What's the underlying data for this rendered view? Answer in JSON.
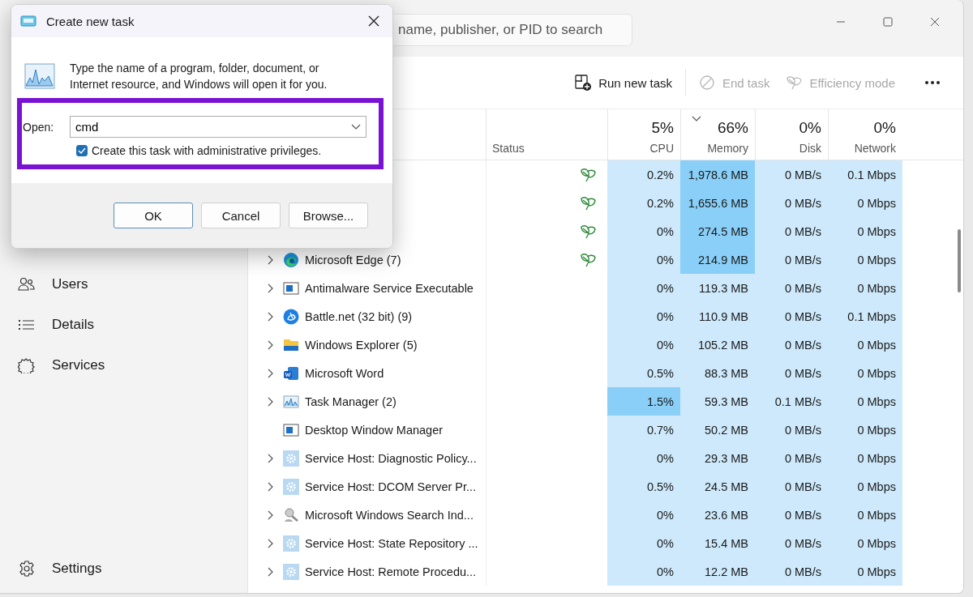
{
  "task_manager": {
    "search": {
      "placeholder": "name, publisher, or PID to search"
    },
    "toolbar": [
      {
        "label": "Run new task",
        "disabled": false
      },
      {
        "label": "End task",
        "disabled": true
      },
      {
        "label": "Efficiency mode",
        "disabled": true
      }
    ],
    "sidebar": {
      "items": [
        {
          "label": "Users"
        },
        {
          "label": "Details"
        },
        {
          "label": "Services"
        }
      ],
      "footer": {
        "label": "Settings"
      }
    },
    "table": {
      "status_header": {
        "label": "Status"
      },
      "columns": [
        {
          "percent": "5%",
          "label": "CPU",
          "sorted": false
        },
        {
          "percent": "66%",
          "label": "Memory",
          "sorted": true
        },
        {
          "percent": "0%",
          "label": "Disk",
          "sorted": false
        },
        {
          "percent": "0%",
          "label": "Network",
          "sorted": false
        }
      ],
      "rows": [
        {
          "efficiency": true,
          "cells": [
            {
              "text": "0.2%",
              "hot": false
            },
            {
              "text": "1,978.6 MB",
              "hot": true
            },
            {
              "text": "0 MB/s",
              "hot": false
            },
            {
              "text": "0.1 Mbps",
              "hot": false
            }
          ]
        },
        {
          "efficiency": true,
          "cells": [
            {
              "text": "0.2%",
              "hot": false
            },
            {
              "text": "1,655.6 MB",
              "hot": true
            },
            {
              "text": "0 MB/s",
              "hot": false
            },
            {
              "text": "0 Mbps",
              "hot": false
            }
          ]
        },
        {
          "efficiency": true,
          "cells": [
            {
              "text": "0%",
              "hot": false
            },
            {
              "text": "274.5 MB",
              "hot": true
            },
            {
              "text": "0 MB/s",
              "hot": false
            },
            {
              "text": "0 Mbps",
              "hot": false
            }
          ]
        },
        {
          "name": "Microsoft Edge (7)",
          "expandable": true,
          "efficiency": true,
          "cells": [
            {
              "text": "0%",
              "hot": false
            },
            {
              "text": "214.9 MB",
              "hot": true
            },
            {
              "text": "0 MB/s",
              "hot": false
            },
            {
              "text": "0 Mbps",
              "hot": false
            }
          ]
        },
        {
          "name": "Antimalware Service Executable",
          "expandable": true,
          "efficiency": false,
          "cells": [
            {
              "text": "0%",
              "hot": false
            },
            {
              "text": "119.3 MB",
              "hot": false
            },
            {
              "text": "0 MB/s",
              "hot": false
            },
            {
              "text": "0 Mbps",
              "hot": false
            }
          ]
        },
        {
          "name": "Battle.net (32 bit) (9)",
          "expandable": true,
          "efficiency": false,
          "cells": [
            {
              "text": "0%",
              "hot": false
            },
            {
              "text": "110.9 MB",
              "hot": false
            },
            {
              "text": "0 MB/s",
              "hot": false
            },
            {
              "text": "0.1 Mbps",
              "hot": false
            }
          ]
        },
        {
          "name": "Windows Explorer (5)",
          "expandable": true,
          "efficiency": false,
          "cells": [
            {
              "text": "0%",
              "hot": false
            },
            {
              "text": "105.2 MB",
              "hot": false
            },
            {
              "text": "0 MB/s",
              "hot": false
            },
            {
              "text": "0 Mbps",
              "hot": false
            }
          ]
        },
        {
          "name": "Microsoft Word",
          "expandable": true,
          "efficiency": false,
          "cells": [
            {
              "text": "0.5%",
              "hot": false
            },
            {
              "text": "88.3 MB",
              "hot": false
            },
            {
              "text": "0 MB/s",
              "hot": false
            },
            {
              "text": "0 Mbps",
              "hot": false
            }
          ]
        },
        {
          "name": "Task Manager (2)",
          "expandable": true,
          "efficiency": false,
          "cells": [
            {
              "text": "1.5%",
              "hot": true
            },
            {
              "text": "59.3 MB",
              "hot": false
            },
            {
              "text": "0.1 MB/s",
              "hot": false
            },
            {
              "text": "0 Mbps",
              "hot": false
            }
          ]
        },
        {
          "name": "Desktop Window Manager",
          "expandable": false,
          "efficiency": false,
          "cells": [
            {
              "text": "0.7%",
              "hot": false
            },
            {
              "text": "50.2 MB",
              "hot": false
            },
            {
              "text": "0 MB/s",
              "hot": false
            },
            {
              "text": "0 Mbps",
              "hot": false
            }
          ]
        },
        {
          "name": "Service Host: Diagnostic Policy...",
          "expandable": true,
          "efficiency": false,
          "cells": [
            {
              "text": "0%",
              "hot": false
            },
            {
              "text": "29.3 MB",
              "hot": false
            },
            {
              "text": "0 MB/s",
              "hot": false
            },
            {
              "text": "0 Mbps",
              "hot": false
            }
          ]
        },
        {
          "name": "Service Host: DCOM Server Pr...",
          "expandable": true,
          "efficiency": false,
          "cells": [
            {
              "text": "0.5%",
              "hot": false
            },
            {
              "text": "24.5 MB",
              "hot": false
            },
            {
              "text": "0 MB/s",
              "hot": false
            },
            {
              "text": "0 Mbps",
              "hot": false
            }
          ]
        },
        {
          "name": "Microsoft Windows Search Ind...",
          "expandable": true,
          "efficiency": false,
          "cells": [
            {
              "text": "0%",
              "hot": false
            },
            {
              "text": "23.6 MB",
              "hot": false
            },
            {
              "text": "0 MB/s",
              "hot": false
            },
            {
              "text": "0 Mbps",
              "hot": false
            }
          ]
        },
        {
          "name": "Service Host: State Repository ...",
          "expandable": true,
          "efficiency": false,
          "cells": [
            {
              "text": "0%",
              "hot": false
            },
            {
              "text": "15.4 MB",
              "hot": false
            },
            {
              "text": "0 MB/s",
              "hot": false
            },
            {
              "text": "0 Mbps",
              "hot": false
            }
          ]
        },
        {
          "name": "Service Host: Remote Procedu...",
          "expandable": true,
          "efficiency": false,
          "cells": [
            {
              "text": "0%",
              "hot": false
            },
            {
              "text": "12.2 MB",
              "hot": false
            },
            {
              "text": "0 MB/s",
              "hot": false
            },
            {
              "text": "0 Mbps",
              "hot": false
            }
          ]
        }
      ]
    }
  },
  "dialog": {
    "title": "Create new task",
    "message": "Type the name of a program, folder, document, or Internet resource, and Windows will open it for you.",
    "open_label": "Open:",
    "open_value": "cmd",
    "admin_checkbox": {
      "label": "Create this task with administrative privileges.",
      "checked": true
    },
    "buttons": [
      {
        "label": "OK",
        "default": true
      },
      {
        "label": "Cancel",
        "default": false
      },
      {
        "label": "Browse...",
        "default": false
      }
    ]
  }
}
